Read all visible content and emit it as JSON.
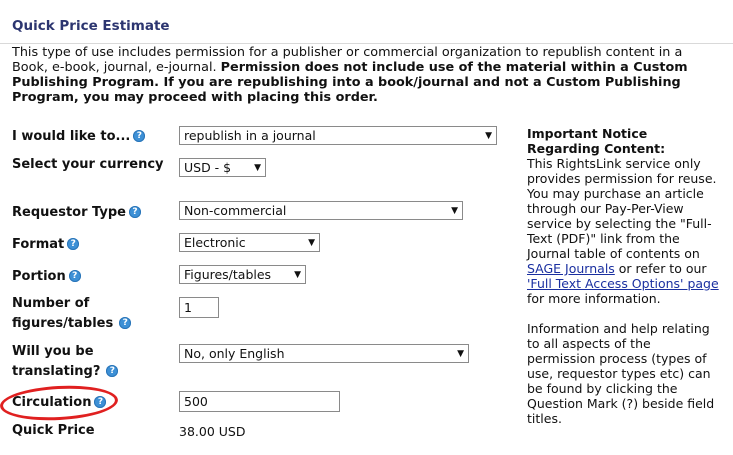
{
  "page": {
    "title": "Quick Price Estimate",
    "intro_normal": "This type of use includes permission for a publisher or commercial organization to republish content in a Book, e-book, journal, e-journal. ",
    "intro_bold": "Permission does not include use of the material within a Custom Publishing Program. If you are republishing into a book/journal and not a Custom Publishing Program, you may proceed with placing this order."
  },
  "form": {
    "i_would_like_label": "I would like to...",
    "i_would_like_value": "republish in a journal",
    "currency_label": "Select your currency",
    "currency_value": "USD - $",
    "requestor_label": "Requestor Type",
    "requestor_value": "Non-commercial",
    "format_label": "Format",
    "format_value": "Electronic",
    "portion_label": "Portion",
    "portion_value": "Figures/tables",
    "number_label_line1": "Number of",
    "number_label_line2": "figures/tables",
    "number_value": "1",
    "translating_label_line1": "Will you be",
    "translating_label_line2": "translating?",
    "translating_value": "No, only English",
    "circulation_label": "Circulation",
    "circulation_value": "500",
    "quick_price_label": "Quick Price",
    "quick_price_value": "38.00 USD",
    "help_glyph": "?"
  },
  "notice": {
    "heading": "Important Notice Regarding Content:",
    "text1": "This RightsLink service only provides permission for reuse. You may purchase an article through our Pay-Per-View service by selecting the \"Full-Text (PDF)\" link from the Journal table of contents on ",
    "link1": "SAGE Journals",
    "text2": " or refer to our ",
    "link2": "'Full Text Access Options' page",
    "text3": " for more information.",
    "help_text": "Information and help relating to all aspects of the permission process (types of use, requestor types etc) can be found by clicking the Question Mark (?) beside field titles."
  },
  "colors": {
    "title": "#2c3570",
    "help_icon": "#3d90d6",
    "link": "#1a2fa0",
    "annotation_circle": "#e02020"
  },
  "icons": {
    "help": "question-circle-icon",
    "dropdown": "chevron-down-icon"
  }
}
